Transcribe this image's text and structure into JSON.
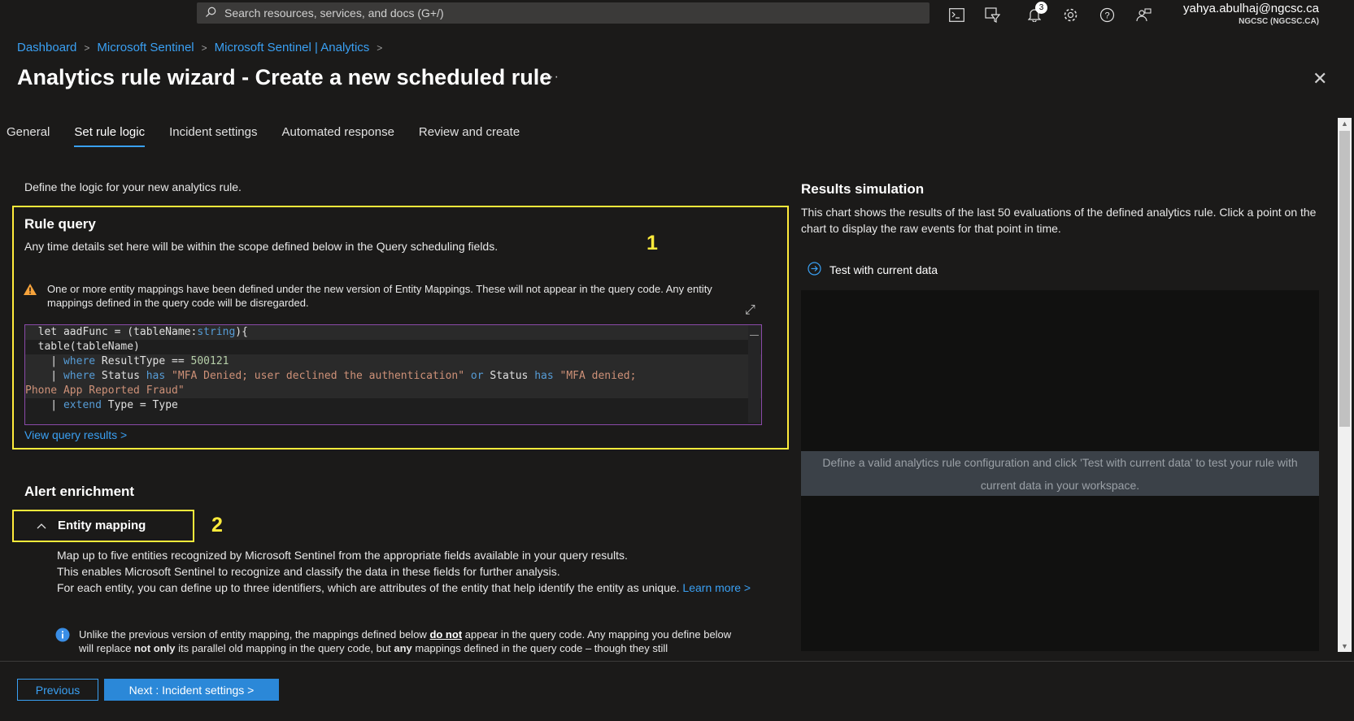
{
  "topbar": {
    "search_placeholder": "Search resources, services, and docs (G+/)",
    "notifications_count": "3",
    "user_email": "yahya.abulhaj@ngcsc.ca",
    "user_tenant": "NGCSC (NGCSC.CA)",
    "icons": [
      "cloud-shell-icon",
      "directory-filter-icon",
      "notifications-icon",
      "settings-icon",
      "help-icon",
      "feedback-icon"
    ]
  },
  "breadcrumb": [
    "Dashboard",
    "Microsoft Sentinel",
    "Microsoft Sentinel | Analytics"
  ],
  "page": {
    "title": "Analytics rule wizard - Create a new scheduled rule",
    "more": "···",
    "close": "✕"
  },
  "tabs": [
    {
      "label": "General",
      "active": false
    },
    {
      "label": "Set rule logic",
      "active": true
    },
    {
      "label": "Incident settings",
      "active": false
    },
    {
      "label": "Automated response",
      "active": false
    },
    {
      "label": "Review and create",
      "active": false
    }
  ],
  "left": {
    "intro": "Define the logic for your new analytics rule.",
    "rule_query_title": "Rule query",
    "rule_query_desc": "Any time details set here will be within the scope defined below in the Query scheduling fields.",
    "annotation1": "1",
    "warning": "One or more entity mappings have been defined under the new version of Entity Mappings. These will not appear in the query code. Any entity mappings defined in the query code will be disregarded.",
    "code_lines": [
      "  let aadFunc = (tableName:string){",
      "  table(tableName)",
      "    | where ResultType == 500121",
      "    | where Status has \"MFA Denied; user declined the authentication\" or Status has \"MFA denied;",
      "Phone App Reported Fraud\"",
      "    | extend Type = Type"
    ],
    "view_query": "View query results >",
    "alert_enrichment": "Alert enrichment",
    "entity_mapping": "Entity mapping",
    "annotation2": "2",
    "entity_desc_1": "Map up to five entities recognized by Microsoft Sentinel from the appropriate fields available in your query results.",
    "entity_desc_2": "This enables Microsoft Sentinel to recognize and classify the data in these fields for further analysis.",
    "entity_desc_3": "For each entity, you can define up to three identifiers, which are attributes of the entity that help identify the entity as unique.",
    "learn_more": "Learn more >",
    "info_1": "Unlike the previous version of entity mapping, the mappings defined below",
    "info_do_not": "do not",
    "info_2": "appear in the query code. Any mapping you define below will replace",
    "info_not_only": "not only",
    "info_3": "its parallel old mapping in the query code, but",
    "info_any": "any",
    "info_4": "mappings defined in the query code – though they still"
  },
  "right": {
    "title": "Results simulation",
    "desc": "This chart shows the results of the last 50 evaluations of the defined analytics rule. Click a point on the chart to display the raw events for that point in time.",
    "test_button": "Test with current data",
    "chart_message": "Define a valid analytics rule configuration and click 'Test with current data' to test your rule with current data in your workspace."
  },
  "footer": {
    "previous": "Previous",
    "next": "Next : Incident settings >"
  },
  "colors": {
    "accent": "#3aa0f3",
    "highlight_box": "#ffeb3b",
    "primary_button": "#2b88d8",
    "background": "#1b1a19"
  }
}
